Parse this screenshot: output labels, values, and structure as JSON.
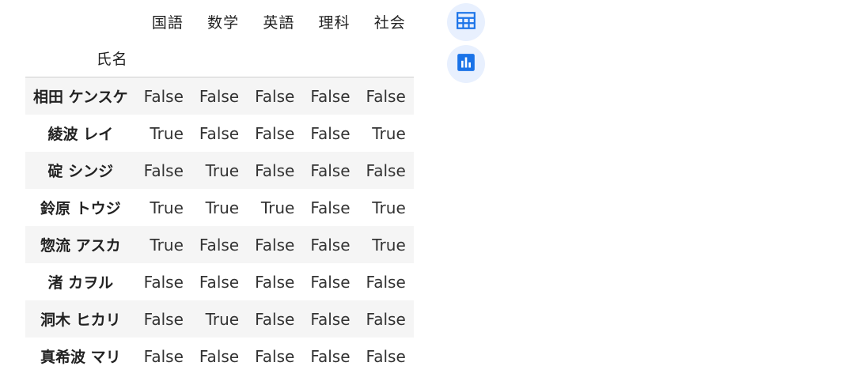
{
  "table": {
    "columns": [
      "国語",
      "数学",
      "英語",
      "理科",
      "社会"
    ],
    "index_name": "氏名",
    "rows": [
      {
        "name": "相田 ケンスケ",
        "values": [
          "False",
          "False",
          "False",
          "False",
          "False"
        ]
      },
      {
        "name": "綾波 レイ",
        "values": [
          "True",
          "False",
          "False",
          "False",
          "True"
        ]
      },
      {
        "name": "碇 シンジ",
        "values": [
          "False",
          "True",
          "False",
          "False",
          "False"
        ]
      },
      {
        "name": "鈴原 トウジ",
        "values": [
          "True",
          "True",
          "True",
          "False",
          "True"
        ]
      },
      {
        "name": "惣流 アスカ",
        "values": [
          "True",
          "False",
          "False",
          "False",
          "True"
        ]
      },
      {
        "name": "渚 カヲル",
        "values": [
          "False",
          "False",
          "False",
          "False",
          "False"
        ]
      },
      {
        "name": "洞木 ヒカリ",
        "values": [
          "False",
          "True",
          "False",
          "False",
          "False"
        ]
      },
      {
        "name": "真希波 マリ",
        "values": [
          "False",
          "False",
          "False",
          "False",
          "False"
        ]
      }
    ]
  },
  "actions": {
    "table_icon": "table-grid-icon",
    "chart_icon": "bar-chart-icon"
  },
  "colors": {
    "accent": "#1a73e8",
    "button_bg": "#e8f0fe",
    "stripe": "#f5f5f5"
  }
}
